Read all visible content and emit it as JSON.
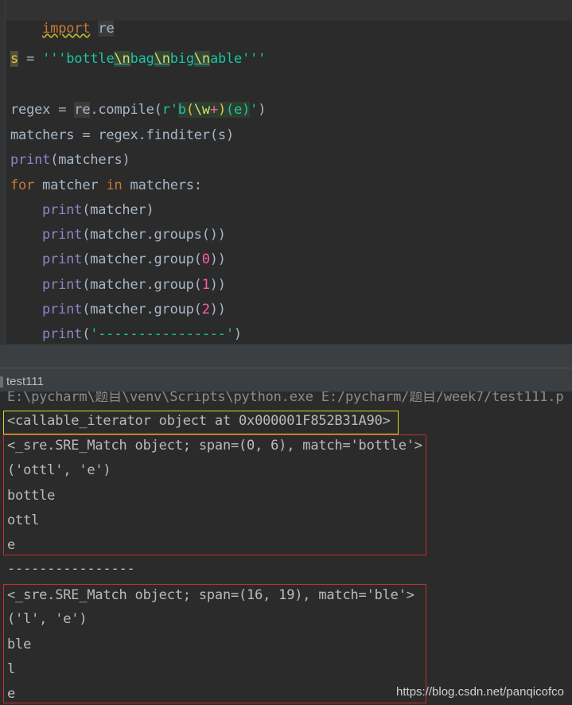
{
  "editor": {
    "line1": {
      "kw": "import",
      "mod": "re"
    },
    "line2": {
      "var": "s",
      "eq": " = ",
      "q1": "'''",
      "p1": "bottle",
      "e1": "\\n",
      "p2": "bag",
      "e2": "\\n",
      "p3": "big",
      "e3": "\\n",
      "p4": "able",
      "q2": "'''"
    },
    "line3": {
      "a": "regex = ",
      "mod": "re",
      "b": ".compile(",
      "rprefix": "r'",
      "r1": "b",
      "r2": "(",
      "r3": "\\w",
      "r4": "+",
      "r5": ")",
      "r6": "(",
      "r7": "e",
      "r8": ")",
      "rq": "'",
      "c": ")"
    },
    "line4": "matchers = regex.finditer(s)",
    "line5": {
      "fn": "print",
      "rest": "(matchers)"
    },
    "line6": {
      "kw1": "for",
      "a": " matcher ",
      "kw2": "in",
      "b": " matchers:"
    },
    "line7": {
      "fn": "print",
      "rest": "(matcher)"
    },
    "line8": {
      "fn": "print",
      "rest": "(matcher.groups())"
    },
    "line9": {
      "fn": "print",
      "a": "(matcher.group(",
      "n": "0",
      "b": "))"
    },
    "line10": {
      "fn": "print",
      "a": "(matcher.group(",
      "n": "1",
      "b": "))"
    },
    "line11": {
      "fn": "print",
      "a": "(matcher.group(",
      "n": "2",
      "b": "))"
    },
    "line12": {
      "fn": "print",
      "a": "(",
      "s": "'----------------'",
      "b": ")"
    }
  },
  "run_tab": {
    "label": "test111"
  },
  "console": {
    "cmd": "E:\\pycharm\\题目\\venv\\Scripts\\python.exe E:/pycharm/题目/week7/test111.p",
    "iter": "<callable_iterator object at 0x000001F852B31A90>",
    "m1": "<_sre.SRE_Match object; span=(0, 6), match='bottle'>",
    "m1_groups": "('ottl', 'e')",
    "m1_g0": "bottle",
    "m1_g1": "ottl",
    "m1_g2": "e",
    "sep": "----------------",
    "m2": "<_sre.SRE_Match object; span=(16, 19), match='ble'>",
    "m2_groups": "('l', 'e')",
    "m2_g0": "ble",
    "m2_g1": "l",
    "m2_g2": "e"
  },
  "watermark": "https://blog.csdn.net/panqicofco",
  "colors": {
    "keyword": "#cc7832",
    "builtin": "#8888c6",
    "string": "#17c6a3",
    "number": "#ff5fa2",
    "highlight_box": "#d7d72a",
    "match_box": "#c03030"
  }
}
